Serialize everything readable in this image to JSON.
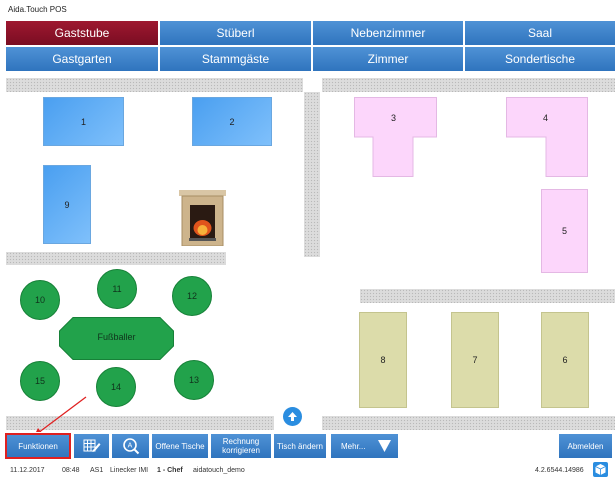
{
  "window": {
    "title": "Aida.Touch POS"
  },
  "rooms": {
    "row1": [
      {
        "label": "Gaststube",
        "active": true
      },
      {
        "label": "Stüberl",
        "active": false
      },
      {
        "label": "Nebenzimmer",
        "active": false
      },
      {
        "label": "Saal",
        "active": false
      }
    ],
    "row2": [
      {
        "label": "Gastgarten",
        "active": false
      },
      {
        "label": "Stammgäste",
        "active": false
      },
      {
        "label": "Zimmer",
        "active": false
      },
      {
        "label": "Sondertische",
        "active": false
      }
    ]
  },
  "tables": {
    "t1": "1",
    "t2": "2",
    "t3": "3",
    "t4": "4",
    "t5": "5",
    "t6": "6",
    "t7": "7",
    "t8": "8",
    "t9": "9",
    "t10": "10",
    "t11": "11",
    "t12": "12",
    "t13": "13",
    "t14": "14",
    "t15": "15",
    "fussballer": "Fußballer"
  },
  "toolbar": {
    "funktionen": "Funktionen",
    "offene_tische": "Offene Tische",
    "rechnung_line1": "Rechnung",
    "rechnung_line2": "korrigieren",
    "tisch_aendern": "Tisch ändern",
    "mehr": "Mehr...",
    "abmelden": "Abmelden"
  },
  "status": {
    "date": "11.12.2017",
    "time": "08:48",
    "station": "AS1",
    "user": "Linecker IMI",
    "role": "1 - Chef",
    "database": "aidatouch_demo",
    "version": "4.2.6544.14986"
  },
  "colors": {
    "active_tab": "#8b1028",
    "tab": "#3a7fc8",
    "blue_table": "#5aaaf3",
    "pink_table": "#fcd6fb",
    "khaki_table": "#dcdcaa",
    "round_table": "#22a24b",
    "highlight": "#e02020"
  },
  "icons": [
    "fireplace-icon",
    "scroll-up-icon",
    "table-edit-icon",
    "search-table-icon",
    "dropdown-arrow-icon",
    "info-box-icon"
  ]
}
